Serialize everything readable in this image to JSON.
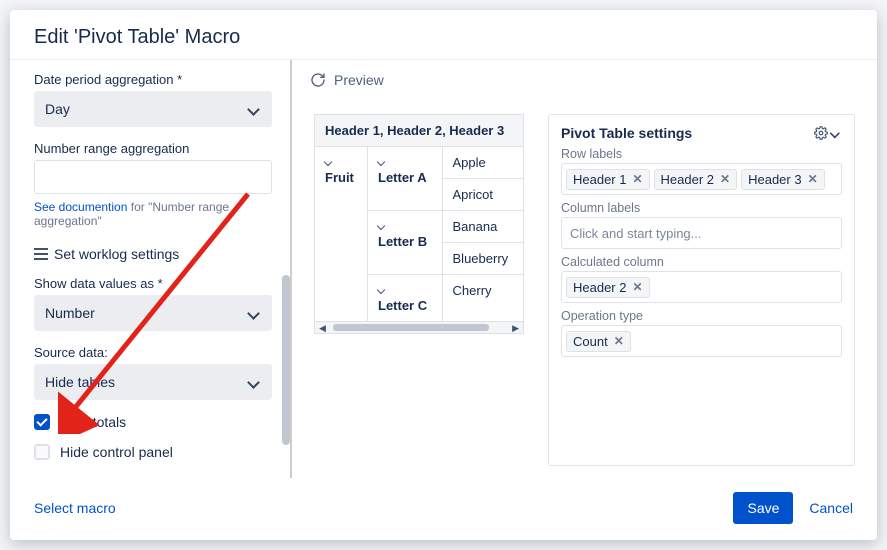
{
  "modal": {
    "title": "Edit 'Pivot Table' Macro"
  },
  "form": {
    "date_period": {
      "label": "Date period aggregation *",
      "value": "Day"
    },
    "number_range": {
      "label": "Number range aggregation",
      "value": ""
    },
    "helper_link": "See documention",
    "helper_rest": " for \"Number range aggregation\"",
    "worklog": "Set worklog settings",
    "show_as": {
      "label": "Show data values as *",
      "value": "Number"
    },
    "source": {
      "label": "Source data:",
      "value": "Hide tables"
    },
    "hide_totals": "Hide totals",
    "hide_control": "Hide control panel"
  },
  "preview": {
    "label": "Preview",
    "header": "Header 1, Header 2, Header 3",
    "row_group": "Fruit",
    "subgroups": [
      "Letter A",
      "Letter B",
      "Letter C"
    ],
    "cells": [
      [
        "Apple",
        "Apricot"
      ],
      [
        "Banana",
        "Blueberry"
      ],
      [
        "Cherry"
      ]
    ]
  },
  "settings": {
    "title": "Pivot Table settings",
    "row_labels_label": "Row labels",
    "row_labels": [
      "Header 1",
      "Header 2",
      "Header 3"
    ],
    "column_labels_label": "Column labels",
    "column_placeholder": "Click and start typing...",
    "calc_label": "Calculated column",
    "calc": [
      "Header 2"
    ],
    "op_label": "Operation type",
    "op": [
      "Count"
    ]
  },
  "footer": {
    "select_macro": "Select macro",
    "save": "Save",
    "cancel": "Cancel"
  }
}
